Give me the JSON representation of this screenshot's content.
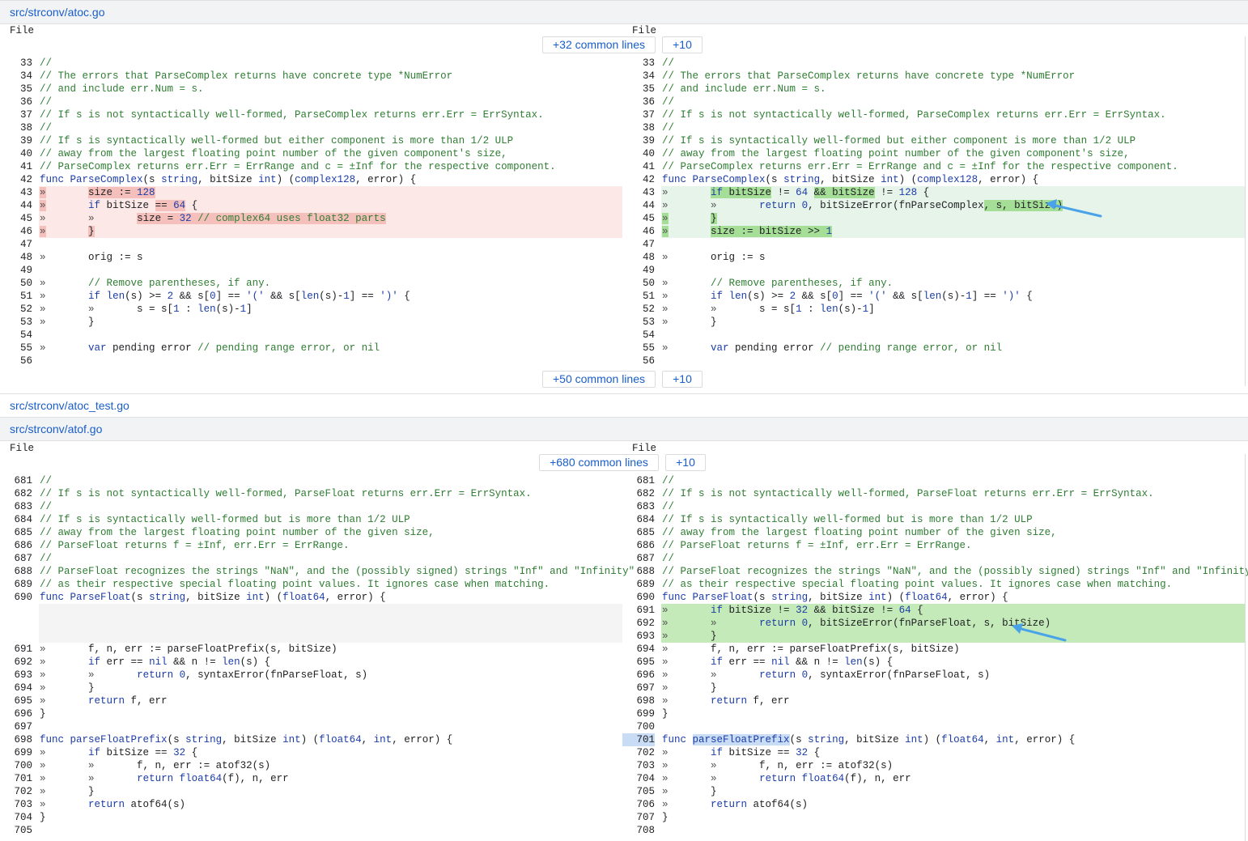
{
  "files": [
    {
      "path": "src/strconv/atoc.go"
    },
    {
      "path": "src/strconv/atoc_test.go"
    },
    {
      "path": "src/strconv/atof.go"
    }
  ],
  "pane_label": "File",
  "expanders": {
    "atoc_top": {
      "common": "+32 common lines",
      "more": "+10"
    },
    "atoc_bottom": {
      "common": "+50 common lines",
      "more": "+10"
    },
    "atof_top": {
      "common": "+680 common lines",
      "more": "+10"
    }
  },
  "atoc": {
    "left": [
      {
        "ln": "33",
        "html": "<span class='c'>//</span>"
      },
      {
        "ln": "34",
        "html": "<span class='c'>// The errors that ParseComplex returns have concrete type *NumError</span>"
      },
      {
        "ln": "35",
        "html": "<span class='c'>// and include err.Num = s.</span>"
      },
      {
        "ln": "36",
        "html": "<span class='c'>//</span>"
      },
      {
        "ln": "37",
        "html": "<span class='c'>// If s is not syntactically well-formed, ParseComplex returns err.Err = ErrSyntax.</span>"
      },
      {
        "ln": "38",
        "html": "<span class='c'>//</span>"
      },
      {
        "ln": "39",
        "html": "<span class='c'>// If s is syntactically well-formed but either component is more than 1/2 ULP</span>"
      },
      {
        "ln": "40",
        "html": "<span class='c'>// away from the largest floating point number of the given component's size,</span>"
      },
      {
        "ln": "41",
        "html": "<span class='c'>// ParseComplex returns err.Err = ErrRange and c = ±Inf for the respective component.</span>"
      },
      {
        "ln": "42",
        "html": "<span class='k'>func</span> <span class='f'>ParseComplex</span>(s <span class='t'>string</span>, bitSize <span class='t'>int</span>) (<span class='t'>complex128</span>, error) {"
      },
      {
        "ln": "43",
        "cls": "del",
        "html": "<span class='tab dmark'>»</span>       <span class='dmark'>size := <span class='n'>128</span></span>"
      },
      {
        "ln": "44",
        "cls": "del",
        "html": "<span class='tab dmark'>»</span>       <span class='k'>if</span> bitSize <span class='dmark'>== <span class='n'>64</span></span> {"
      },
      {
        "ln": "45",
        "cls": "del",
        "html": "<span class='tab'>»</span>       <span class='tab'>»</span>       <span class='dmark'>size = <span class='n'>32</span> <span class='c'>// complex64 uses float32 parts</span></span>"
      },
      {
        "ln": "46",
        "cls": "del",
        "html": "<span class='tab dmark'>»</span>       <span class='dmark'>}</span>"
      },
      {
        "ln": "47",
        "html": ""
      },
      {
        "ln": "48",
        "html": "<span class='tab'>»</span>       orig := s"
      },
      {
        "ln": "49",
        "html": ""
      },
      {
        "ln": "50",
        "html": "<span class='tab'>»</span>       <span class='c'>// Remove parentheses, if any.</span>"
      },
      {
        "ln": "51",
        "html": "<span class='tab'>»</span>       <span class='k'>if</span> <span class='f'>len</span>(s) >= <span class='n'>2</span> && s[<span class='n'>0</span>] == <span class='s'>'('</span> && s[<span class='f'>len</span>(s)-<span class='n'>1</span>] == <span class='s'>')'</span> {"
      },
      {
        "ln": "52",
        "html": "<span class='tab'>»</span>       <span class='tab'>»</span>       s = s[<span class='n'>1</span> : <span class='f'>len</span>(s)-<span class='n'>1</span>]"
      },
      {
        "ln": "53",
        "html": "<span class='tab'>»</span>       }"
      },
      {
        "ln": "54",
        "html": ""
      },
      {
        "ln": "55",
        "html": "<span class='tab'>»</span>       <span class='k'>var</span> pending error <span class='c'>// pending range error, or nil</span>"
      },
      {
        "ln": "56",
        "html": ""
      }
    ],
    "right": [
      {
        "ln": "33",
        "html": "<span class='c'>//</span>"
      },
      {
        "ln": "34",
        "html": "<span class='c'>// The errors that ParseComplex returns have concrete type *NumError</span>"
      },
      {
        "ln": "35",
        "html": "<span class='c'>// and include err.Num = s.</span>"
      },
      {
        "ln": "36",
        "html": "<span class='c'>//</span>"
      },
      {
        "ln": "37",
        "html": "<span class='c'>// If s is not syntactically well-formed, ParseComplex returns err.Err = ErrSyntax.</span>"
      },
      {
        "ln": "38",
        "html": "<span class='c'>//</span>"
      },
      {
        "ln": "39",
        "html": "<span class='c'>// If s is syntactically well-formed but either component is more than 1/2 ULP</span>"
      },
      {
        "ln": "40",
        "html": "<span class='c'>// away from the largest floating point number of the given component's size,</span>"
      },
      {
        "ln": "41",
        "html": "<span class='c'>// ParseComplex returns err.Err = ErrRange and c = ±Inf for the respective component.</span>"
      },
      {
        "ln": "42",
        "html": "<span class='k'>func</span> <span class='f'>ParseComplex</span>(s <span class='t'>string</span>, bitSize <span class='t'>int</span>) (<span class='t'>complex128</span>, error) {"
      },
      {
        "ln": "43",
        "cls": "add",
        "html": "<span class='tab'>»</span>       <span class='amark'><span class='k'>if</span> bitSize</span> != <span class='n'>64</span> <span class='amark'>&& bitSize</span> != <span class='n'>128</span> {"
      },
      {
        "ln": "44",
        "cls": "add",
        "html": "<span class='tab'>»</span>       <span class='tab'>»</span>       <span class='k'>return</span> <span class='n'>0</span>, bitSizeError(fnParseComplex<span class='amark'>, s, bitSize)</span>"
      },
      {
        "ln": "45",
        "cls": "add",
        "html": "<span class='tab amark'>»</span>       <span class='amark'>}</span>"
      },
      {
        "ln": "46",
        "cls": "add",
        "html": "<span class='tab amark'>»</span>       <span class='amark'>size := bitSize >> <span class='n'>1</span></span>"
      },
      {
        "ln": "47",
        "html": ""
      },
      {
        "ln": "48",
        "html": "<span class='tab'>»</span>       orig := s"
      },
      {
        "ln": "49",
        "html": ""
      },
      {
        "ln": "50",
        "html": "<span class='tab'>»</span>       <span class='c'>// Remove parentheses, if any.</span>"
      },
      {
        "ln": "51",
        "html": "<span class='tab'>»</span>       <span class='k'>if</span> <span class='f'>len</span>(s) >= <span class='n'>2</span> && s[<span class='n'>0</span>] == <span class='s'>'('</span> && s[<span class='f'>len</span>(s)-<span class='n'>1</span>] == <span class='s'>')'</span> {"
      },
      {
        "ln": "52",
        "html": "<span class='tab'>»</span>       <span class='tab'>»</span>       s = s[<span class='n'>1</span> : <span class='f'>len</span>(s)-<span class='n'>1</span>]"
      },
      {
        "ln": "53",
        "html": "<span class='tab'>»</span>       }"
      },
      {
        "ln": "54",
        "html": ""
      },
      {
        "ln": "55",
        "html": "<span class='tab'>»</span>       <span class='k'>var</span> pending error <span class='c'>// pending range error, or nil</span>"
      },
      {
        "ln": "56",
        "html": ""
      }
    ]
  },
  "atof": {
    "left": [
      {
        "ln": "681",
        "html": "<span class='c'>//</span>"
      },
      {
        "ln": "682",
        "html": "<span class='c'>// If s is not syntactically well-formed, ParseFloat returns err.Err = ErrSyntax.</span>"
      },
      {
        "ln": "683",
        "html": "<span class='c'>//</span>"
      },
      {
        "ln": "684",
        "html": "<span class='c'>// If s is syntactically well-formed but is more than 1/2 ULP</span>"
      },
      {
        "ln": "685",
        "html": "<span class='c'>// away from the largest floating point number of the given size,</span>"
      },
      {
        "ln": "686",
        "html": "<span class='c'>// ParseFloat returns f = ±Inf, err.Err = ErrRange.</span>"
      },
      {
        "ln": "687",
        "html": "<span class='c'>//</span>"
      },
      {
        "ln": "688",
        "html": "<span class='c'>// ParseFloat recognizes the strings \"NaN\", and the (possibly signed) strings \"Inf\" and \"Infinity\"</span>"
      },
      {
        "ln": "689",
        "html": "<span class='c'>// as their respective special floating point values. It ignores case when matching.</span>"
      },
      {
        "ln": "690",
        "html": "<span class='k'>func</span> <span class='f'>ParseFloat</span>(s <span class='t'>string</span>, bitSize <span class='t'>int</span>) (<span class='t'>float64</span>, error) {"
      },
      {
        "ln": "",
        "cls": "blank",
        "html": ""
      },
      {
        "ln": "",
        "cls": "blank",
        "html": ""
      },
      {
        "ln": "",
        "cls": "blank",
        "html": ""
      },
      {
        "ln": "691",
        "html": "<span class='tab'>»</span>       f, n, err := parseFloatPrefix(s, bitSize)"
      },
      {
        "ln": "692",
        "html": "<span class='tab'>»</span>       <span class='k'>if</span> err == <span class='k'>nil</span> && n != <span class='f'>len</span>(s) {"
      },
      {
        "ln": "693",
        "html": "<span class='tab'>»</span>       <span class='tab'>»</span>       <span class='k'>return</span> <span class='n'>0</span>, syntaxError(fnParseFloat, s)"
      },
      {
        "ln": "694",
        "html": "<span class='tab'>»</span>       }"
      },
      {
        "ln": "695",
        "html": "<span class='tab'>»</span>       <span class='k'>return</span> f, err"
      },
      {
        "ln": "696",
        "html": "}"
      },
      {
        "ln": "697",
        "html": ""
      },
      {
        "ln": "698",
        "html": "<span class='k'>func</span> <span class='f'>parseFloatPrefix</span>(s <span class='t'>string</span>, bitSize <span class='t'>int</span>) (<span class='t'>float64</span>, <span class='t'>int</span>, error) {"
      },
      {
        "ln": "699",
        "html": "<span class='tab'>»</span>       <span class='k'>if</span> bitSize == <span class='n'>32</span> {"
      },
      {
        "ln": "700",
        "html": "<span class='tab'>»</span>       <span class='tab'>»</span>       f, n, err := atof32(s)"
      },
      {
        "ln": "701",
        "html": "<span class='tab'>»</span>       <span class='tab'>»</span>       <span class='k'>return</span> <span class='t'>float64</span>(f), n, err"
      },
      {
        "ln": "702",
        "html": "<span class='tab'>»</span>       }"
      },
      {
        "ln": "703",
        "html": "<span class='tab'>»</span>       <span class='k'>return</span> atof64(s)"
      },
      {
        "ln": "704",
        "html": "}"
      },
      {
        "ln": "705",
        "html": ""
      }
    ],
    "right": [
      {
        "ln": "681",
        "html": "<span class='c'>//</span>"
      },
      {
        "ln": "682",
        "html": "<span class='c'>// If s is not syntactically well-formed, ParseFloat returns err.Err = ErrSyntax.</span>"
      },
      {
        "ln": "683",
        "html": "<span class='c'>//</span>"
      },
      {
        "ln": "684",
        "html": "<span class='c'>// If s is syntactically well-formed but is more than 1/2 ULP</span>"
      },
      {
        "ln": "685",
        "html": "<span class='c'>// away from the largest floating point number of the given size,</span>"
      },
      {
        "ln": "686",
        "html": "<span class='c'>// ParseFloat returns f = ±Inf, err.Err = ErrRange.</span>"
      },
      {
        "ln": "687",
        "html": "<span class='c'>//</span>"
      },
      {
        "ln": "688",
        "html": "<span class='c'>// ParseFloat recognizes the strings \"NaN\", and the (possibly signed) strings \"Inf\" and \"Infinity\"</span>"
      },
      {
        "ln": "689",
        "html": "<span class='c'>// as their respective special floating point values. It ignores case when matching.</span>"
      },
      {
        "ln": "690",
        "html": "<span class='k'>func</span> <span class='f'>ParseFloat</span>(s <span class='t'>string</span>, bitSize <span class='t'>int</span>) (<span class='t'>float64</span>, error) {"
      },
      {
        "ln": "691",
        "cls": "add2",
        "html": "<span class='tab'>»</span>       <span class='k'>if</span> bitSize != <span class='n'>32</span> && bitSize != <span class='n'>64</span> {"
      },
      {
        "ln": "692",
        "cls": "add2",
        "html": "<span class='tab'>»</span>       <span class='tab'>»</span>       <span class='k'>return</span> <span class='n'>0</span>, bitSizeError(fnParseFloat, s, bitSize)"
      },
      {
        "ln": "693",
        "cls": "add2",
        "html": "<span class='tab'>»</span>       }"
      },
      {
        "ln": "694",
        "html": "<span class='tab'>»</span>       f, n, err := parseFloatPrefix(s, bitSize)"
      },
      {
        "ln": "695",
        "html": "<span class='tab'>»</span>       <span class='k'>if</span> err == <span class='k'>nil</span> && n != <span class='f'>len</span>(s) {"
      },
      {
        "ln": "696",
        "html": "<span class='tab'>»</span>       <span class='tab'>»</span>       <span class='k'>return</span> <span class='n'>0</span>, syntaxError(fnParseFloat, s)"
      },
      {
        "ln": "697",
        "html": "<span class='tab'>»</span>       }"
      },
      {
        "ln": "698",
        "html": "<span class='tab'>»</span>       <span class='k'>return</span> f, err"
      },
      {
        "ln": "699",
        "html": "}"
      },
      {
        "ln": "700",
        "html": ""
      },
      {
        "ln": "701",
        "cls": "hl",
        "html": "<span class='k'>func</span> <span class='f fhl'>parseFloatPrefix</span>(s <span class='t'>string</span>, bitSize <span class='t'>int</span>) (<span class='t'>float64</span>, <span class='t'>int</span>, error) {"
      },
      {
        "ln": "702",
        "html": "<span class='tab'>»</span>       <span class='k'>if</span> bitSize == <span class='n'>32</span> {"
      },
      {
        "ln": "703",
        "html": "<span class='tab'>»</span>       <span class='tab'>»</span>       f, n, err := atof32(s)"
      },
      {
        "ln": "704",
        "html": "<span class='tab'>»</span>       <span class='tab'>»</span>       <span class='k'>return</span> <span class='t'>float64</span>(f), n, err"
      },
      {
        "ln": "705",
        "html": "<span class='tab'>»</span>       }"
      },
      {
        "ln": "706",
        "html": "<span class='tab'>»</span>       <span class='k'>return</span> atof64(s)"
      },
      {
        "ln": "707",
        "html": "}"
      },
      {
        "ln": "708",
        "html": ""
      }
    ]
  },
  "annotation_color": "#4aa3e8"
}
